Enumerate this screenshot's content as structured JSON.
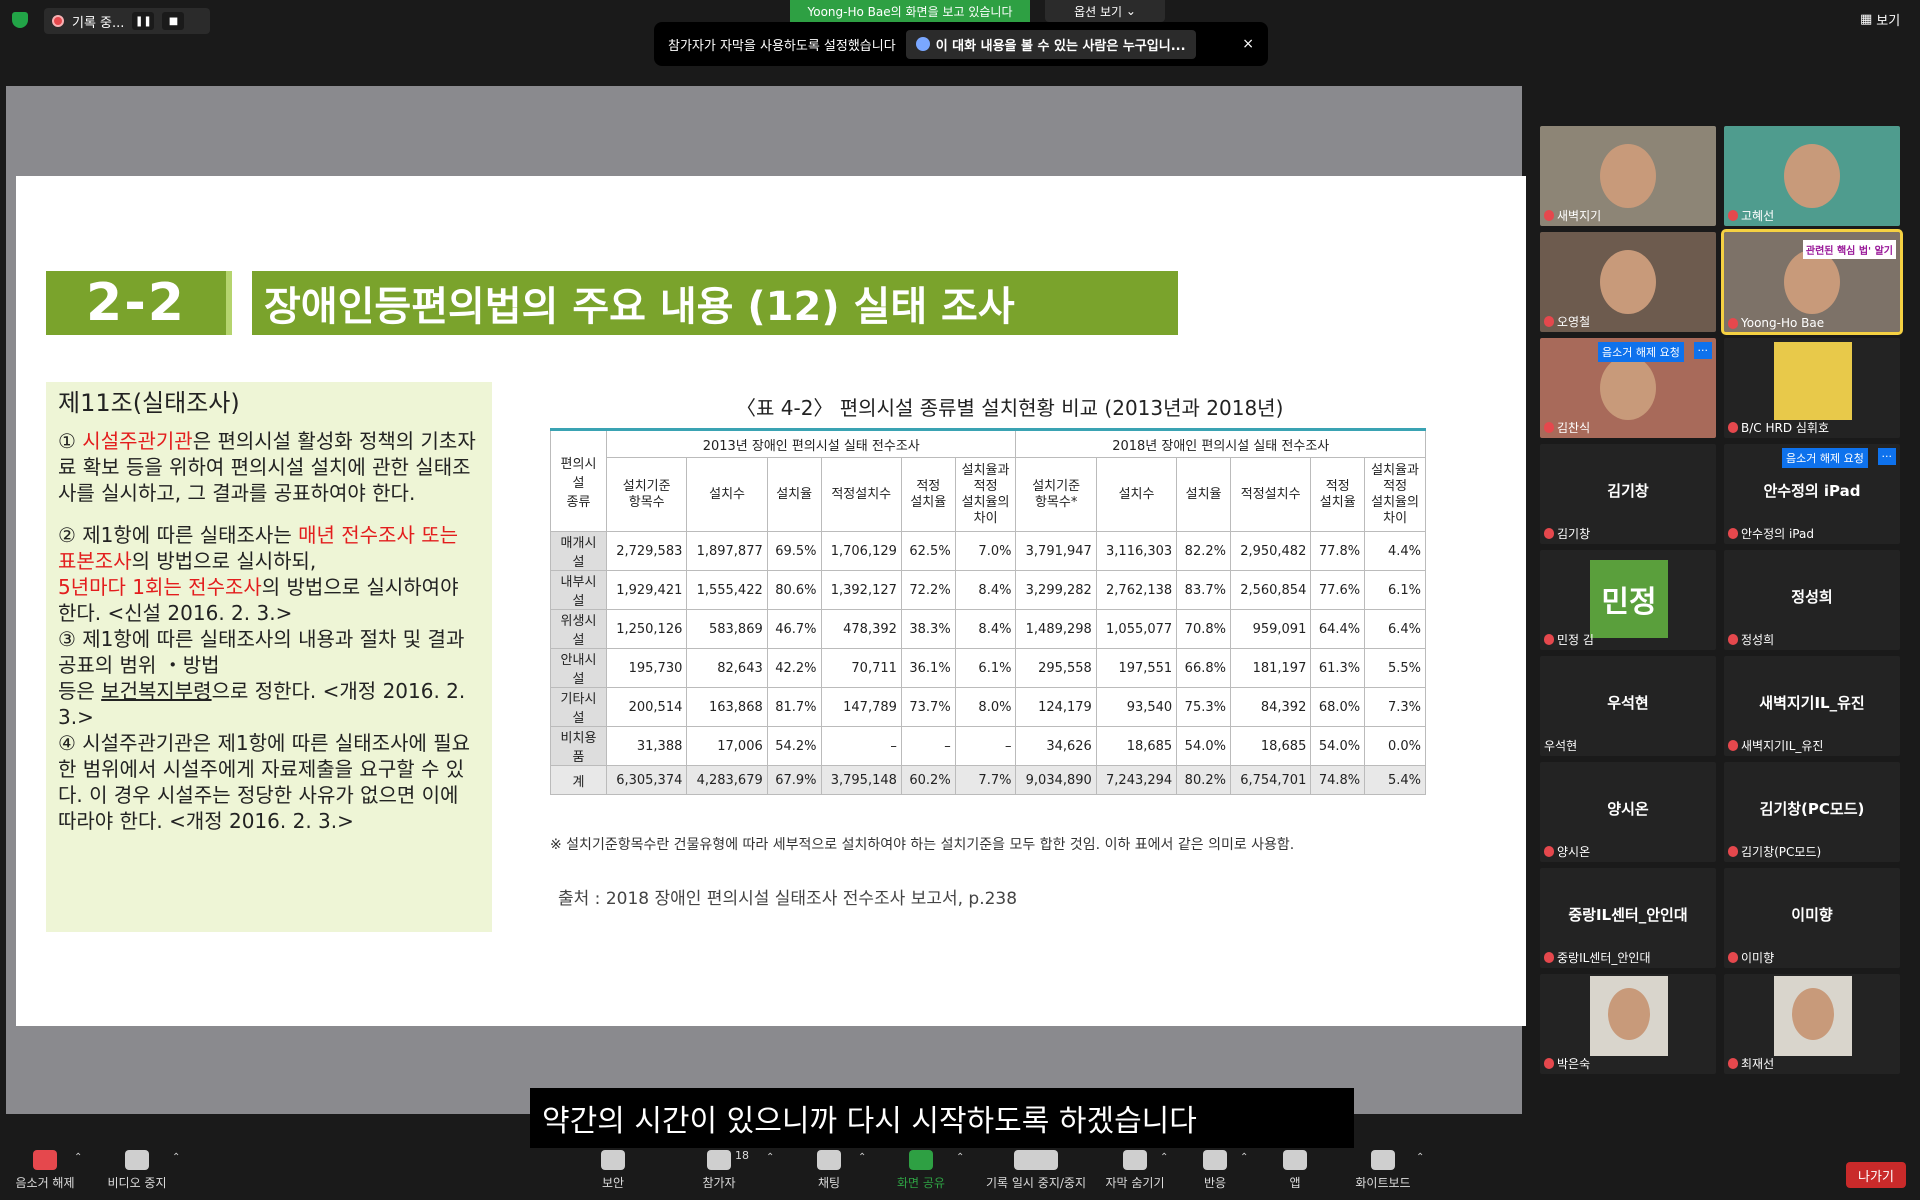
{
  "topbar": {
    "recording_label": "기록 중...",
    "viewing_banner": "Yoong-Ho Bae의 화면을 보고 있습니다",
    "view_options": "옵션 보기",
    "caption_notice": "참가자가 자막을 사용하도록 설정했습니다",
    "caption_who": "이 대화 내용을 볼 수 있는 사람은 누구입니...",
    "close": "×",
    "view_button": "보기"
  },
  "slide": {
    "number": "2-2",
    "title": "장애인등편의법의 주요 내용 (12) 실태 조사",
    "article_head": "제11조(실태조사)",
    "p1_a": "① ",
    "p1_red": "시설주관기관",
    "p1_b": "은 편의시설 활성화 정책의 기초자료 확보 등을 위하여 편의시설 설치에 관한 실태조사를 실시하고, 그 결과를 공표하여야 한다.",
    "p2_a": "② 제1항에 따른 실태조사는 ",
    "p2_red1": "매년 전수조사 또는 표본조사",
    "p2_b": "의 방법으로 실시하되,",
    "p2_red2": "5년마다 1회는 전수조사",
    "p2_c": "의 방법으로 실시하여야 한다. <신설 2016. 2. 3.>",
    "p3_a": "③ 제1항에 따른 실태조사의 내용과 절차 및 결과 공표의 범위 ・방법",
    "p3_b": "등은 ",
    "p3_u": "보건복지부령",
    "p3_c": "으로 정한다. <개정 2016. 2. 3.>",
    "p4": "④ 시설주관기관은 제1항에 따른 실태조사에 필요한 범위에서 시설주에게 자료제출을 요구할 수 있다. 이 경우 시설주는 정당한 사유가 없으면 이에 따라야 한다. <개정 2016. 2. 3.>",
    "table_title": "〈표 4-2〉 편의시설 종류별 설치현황 비교 (2013년과 2018년)",
    "group_2013": "2013년 장애인 편의시설 실태 전수조사",
    "group_2018": "2018년 장애인 편의시설 실태 전수조사",
    "col_type": "편의시설\n종류",
    "cols_2013": [
      "설치기준\n항목수",
      "설치수",
      "설치율",
      "적정설치수",
      "적정\n설치율",
      "설치율과\n적정\n설치율의\n차이"
    ],
    "cols_2018": [
      "설치기준\n항목수*",
      "설치수",
      "설치율",
      "적정설치수",
      "적정\n설치율",
      "설치율과\n적정\n설치율의\n차이"
    ],
    "rows": [
      {
        "cat": "매개시설",
        "v": [
          "2,729,583",
          "1,897,877",
          "69.5%",
          "1,706,129",
          "62.5%",
          "7.0%",
          "3,791,947",
          "3,116,303",
          "82.2%",
          "2,950,482",
          "77.8%",
          "4.4%"
        ]
      },
      {
        "cat": "내부시설",
        "v": [
          "1,929,421",
          "1,555,422",
          "80.6%",
          "1,392,127",
          "72.2%",
          "8.4%",
          "3,299,282",
          "2,762,138",
          "83.7%",
          "2,560,854",
          "77.6%",
          "6.1%"
        ]
      },
      {
        "cat": "위생시설",
        "v": [
          "1,250,126",
          "583,869",
          "46.7%",
          "478,392",
          "38.3%",
          "8.4%",
          "1,489,298",
          "1,055,077",
          "70.8%",
          "959,091",
          "64.4%",
          "6.4%"
        ]
      },
      {
        "cat": "안내시설",
        "v": [
          "195,730",
          "82,643",
          "42.2%",
          "70,711",
          "36.1%",
          "6.1%",
          "295,558",
          "197,551",
          "66.8%",
          "181,197",
          "61.3%",
          "5.5%"
        ]
      },
      {
        "cat": "기타시설",
        "v": [
          "200,514",
          "163,868",
          "81.7%",
          "147,789",
          "73.7%",
          "8.0%",
          "124,179",
          "93,540",
          "75.3%",
          "84,392",
          "68.0%",
          "7.3%"
        ]
      },
      {
        "cat": "비치용품",
        "v": [
          "31,388",
          "17,006",
          "54.2%",
          "–",
          "–",
          "–",
          "34,626",
          "18,685",
          "54.0%",
          "18,685",
          "54.0%",
          "0.0%"
        ]
      },
      {
        "cat": "계",
        "v": [
          "6,305,374",
          "4,283,679",
          "67.9%",
          "3,795,148",
          "60.2%",
          "7.7%",
          "9,034,890",
          "7,243,294",
          "80.2%",
          "6,754,701",
          "74.8%",
          "5.4%"
        ]
      }
    ],
    "note": "※ 설치기준항목수란 건물유형에 따라 세부적으로 설치하여야 하는 설치기준을 모두 합한 것임.   이하 표에서 같은 의미로 사용함.",
    "source": "출처 : 2018 장애인 편의시설 실태조사 전수조사 보고서, p.238"
  },
  "live_caption": "약간의 시간이 있으니까 다시 시작하도록 하겠습니다",
  "gallery": {
    "tiles": [
      {
        "name": "새벽지기",
        "big": "",
        "video": true,
        "bg": "#8d8576"
      },
      {
        "name": "고혜선",
        "big": "",
        "video": true,
        "bg": "#4f9c8e"
      },
      {
        "name": "오영철",
        "big": "",
        "video": true,
        "bg": "#6d5b4e"
      },
      {
        "name": "Yoong-Ho Bae",
        "big": "",
        "video": true,
        "bg": "#7d7268",
        "active": true,
        "banner": "관련된 핵심 법' 알기"
      },
      {
        "name": "김찬식",
        "big": "",
        "video": true,
        "bg": "#a86a5a",
        "unmute": "음소거 해제 요청"
      },
      {
        "name": "B/C HRD 심휘호",
        "big": "",
        "video": false,
        "bg": "#232323",
        "logo": true
      },
      {
        "name": "김기창",
        "big": "김기창",
        "video": false,
        "bg": "#232323"
      },
      {
        "name": "안수정의 iPad",
        "big": "안수정의 iPad",
        "video": false,
        "bg": "#232323",
        "unmute": "음소거 해제 요청"
      },
      {
        "name": "민정 김",
        "big": "",
        "video": false,
        "bg": "#232323",
        "avatar": "민정"
      },
      {
        "name": "정성희",
        "big": "정성희",
        "video": false,
        "bg": "#232323"
      },
      {
        "name": "우석현",
        "big": "우석현",
        "video": false,
        "bg": "#232323",
        "nomic": true
      },
      {
        "name": "새벽지기IL_유진",
        "big": "새벽지기IL_유진",
        "video": false,
        "bg": "#232323"
      },
      {
        "name": "양시온",
        "big": "양시온",
        "video": false,
        "bg": "#232323"
      },
      {
        "name": "김기창(PC모드)",
        "big": "김기창(PC모드)",
        "video": false,
        "bg": "#232323"
      },
      {
        "name": "중랑IL센터_안인대",
        "big": "중랑IL센터_안인대",
        "video": false,
        "bg": "#232323"
      },
      {
        "name": "이미향",
        "big": "이미향",
        "video": false,
        "bg": "#232323"
      },
      {
        "name": "박은숙",
        "big": "",
        "video": true,
        "bg": "#232323",
        "face": true
      },
      {
        "name": "최재선",
        "big": "",
        "video": true,
        "bg": "#232323",
        "face": true
      }
    ],
    "more": "···"
  },
  "toolbar": {
    "unmute": "음소거 해제",
    "stop_video": "비디오 중지",
    "security": "보안",
    "participants": "참가자",
    "participants_count": "18",
    "chat": "채팅",
    "share": "화면 공유",
    "record": "기록 일시 중지/중지",
    "captions": "자막 숨기기",
    "reactions": "반응",
    "apps": "앱",
    "whiteboard": "화이트보드",
    "leave": "나가기"
  },
  "colors": {
    "accent_green": "#7aa32c",
    "share_green": "#2ea043",
    "leave_red": "#c92a2a",
    "zoom_blue": "#0e72ed"
  }
}
